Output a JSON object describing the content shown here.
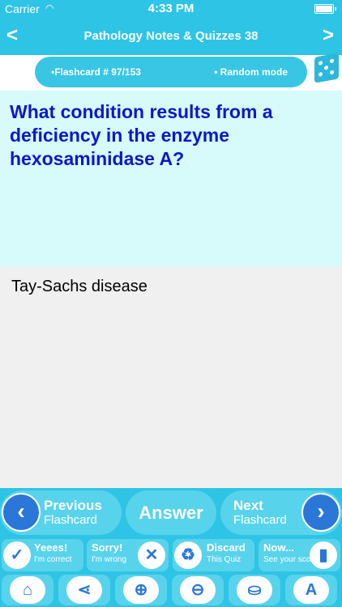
{
  "status_bar": {
    "carrier": "Carrier",
    "time": "4:33 PM"
  },
  "nav": {
    "back": "<",
    "title": "Pathology Notes & Quizzes 38",
    "forward": ">"
  },
  "info": {
    "flashcard": "•Flashcard # 97/153",
    "mode": "• Random mode"
  },
  "question": "What condition results from a deficiency in the enzyme hexosaminidase A?",
  "answer": "Tay-Sachs disease",
  "controls": {
    "previous_title": "Previous",
    "previous_sub": "Flashcard",
    "answer_label": "Answer",
    "next_title": "Next",
    "next_sub": "Flashcard",
    "yes_title": "Yeees!",
    "yes_sub": "I'm correct",
    "sorry_title": "Sorry!",
    "sorry_sub": "I'm wrong",
    "discard_title": "Discard",
    "discard_sub": "This Quiz",
    "now_title": "Now...",
    "now_sub": "See your score"
  },
  "icons": {
    "previous": "chevron-left-icon",
    "next": "chevron-right-icon",
    "yes": "check-icon",
    "sorry": "x-icon",
    "discard": "recycle-icon",
    "now": "bar-chart-icon",
    "home": "home-icon",
    "share": "share-icon",
    "zoom_in": "zoom-in-icon",
    "zoom_out": "zoom-out-icon",
    "bucket": "paint-bucket-icon",
    "font": "font-icon",
    "random": "dice-icon"
  },
  "colors": {
    "bar": "#2ec4e6",
    "pill": "#58d3ec",
    "question_bg": "#d6fbfa",
    "question_text": "#0c18c8",
    "accent": "#2a77d8"
  }
}
